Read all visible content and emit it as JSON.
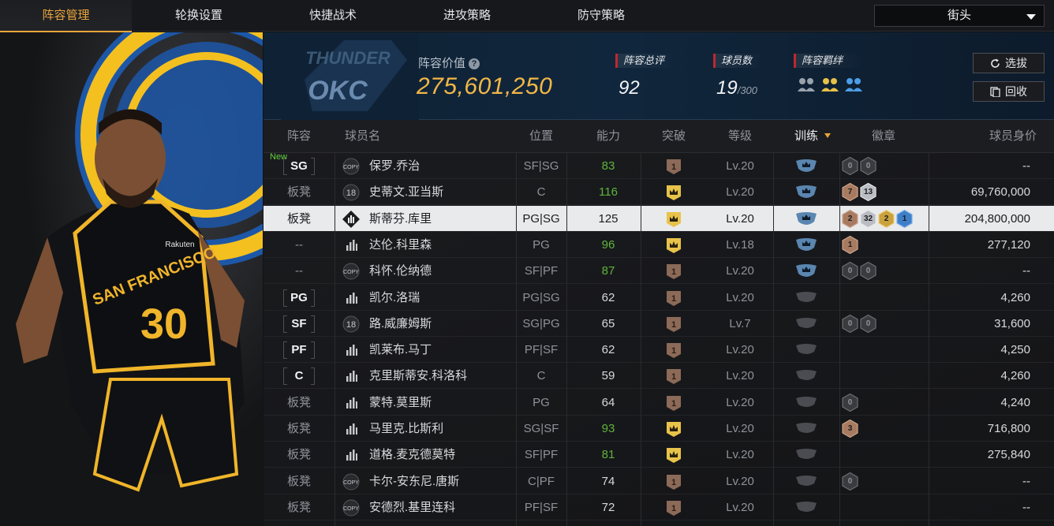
{
  "nav": {
    "tabs": [
      {
        "label": "阵容管理",
        "active": true
      },
      {
        "label": "轮换设置",
        "active": false
      },
      {
        "label": "快捷战术",
        "active": false
      },
      {
        "label": "进攻策略",
        "active": false
      },
      {
        "label": "防守策略",
        "active": false
      }
    ],
    "mode_select": "街头"
  },
  "header": {
    "value_label": "阵容价值",
    "value": "275,601,250",
    "rating_label": "阵容总评",
    "rating": "92",
    "players_label": "球员数",
    "players": "19",
    "players_max": "/300",
    "bond_label": "阵容羁绊",
    "select_button": "选拔",
    "recycle_button": "回收"
  },
  "colors": {
    "accent": "#e8a53c",
    "value_gold": "#f2b746",
    "ability_green": "#5fb43c",
    "stat_red": "#c0272d"
  },
  "table": {
    "columns": [
      "阵容",
      "球员名",
      "位置",
      "能力",
      "突破",
      "等级",
      "训练",
      "徽章",
      "球员身价"
    ],
    "rows": [
      {
        "lineup": "SG",
        "lineup_type": "slot",
        "is_new": true,
        "new_label": "New",
        "tier": "copy",
        "name": "保罗.乔治",
        "position": "SF|SG",
        "ability": "83",
        "ability_green": true,
        "breakthrough": "1",
        "breakthrough_type": "brown",
        "level": "Lv.20",
        "trained": true,
        "badges": [
          {
            "c": "dark",
            "v": "0"
          },
          {
            "c": "dark",
            "v": "0"
          }
        ],
        "price": "--",
        "selected": false
      },
      {
        "lineup": "板凳",
        "lineup_type": "bench",
        "is_new": false,
        "tier": "18",
        "name": "史蒂文.亚当斯",
        "position": "C",
        "ability": "116",
        "ability_green": true,
        "breakthrough": "crown",
        "breakthrough_type": "gold",
        "level": "Lv.20",
        "trained": true,
        "badges": [
          {
            "c": "bronze",
            "v": "7"
          },
          {
            "c": "silver",
            "v": "13"
          }
        ],
        "price": "69,760,000",
        "selected": false
      },
      {
        "lineup": "板凳",
        "lineup_type": "bench",
        "is_new": false,
        "tier": "diamond",
        "name": "斯蒂芬.库里",
        "position": "PG|SG",
        "ability": "125",
        "ability_green": false,
        "breakthrough": "crown",
        "breakthrough_type": "gold",
        "level": "Lv.20",
        "trained": true,
        "badges": [
          {
            "c": "bronze",
            "v": "2"
          },
          {
            "c": "silver",
            "v": "32"
          },
          {
            "c": "gold",
            "v": "2"
          },
          {
            "c": "blue",
            "v": "1"
          }
        ],
        "price": "204,800,000",
        "selected": true
      },
      {
        "lineup": "--",
        "lineup_type": "none",
        "is_new": false,
        "tier": "bars",
        "name": "达伦.科里森",
        "position": "PG",
        "ability": "96",
        "ability_green": true,
        "breakthrough": "crown",
        "breakthrough_type": "gold",
        "level": "Lv.18",
        "trained": true,
        "badges": [
          {
            "c": "bronze",
            "v": "1"
          }
        ],
        "price": "277,120",
        "selected": false
      },
      {
        "lineup": "--",
        "lineup_type": "none",
        "is_new": false,
        "tier": "copy",
        "name": "科怀.伦纳德",
        "position": "SF|PF",
        "ability": "87",
        "ability_green": true,
        "breakthrough": "1",
        "breakthrough_type": "brown",
        "level": "Lv.20",
        "trained": true,
        "badges": [
          {
            "c": "dark",
            "v": "0"
          },
          {
            "c": "dark",
            "v": "0"
          }
        ],
        "price": "--",
        "selected": false
      },
      {
        "lineup": "PG",
        "lineup_type": "slot",
        "is_new": false,
        "tier": "bars",
        "name": "凯尔.洛瑞",
        "position": "PG|SG",
        "ability": "62",
        "ability_green": false,
        "breakthrough": "1",
        "breakthrough_type": "brown",
        "level": "Lv.20",
        "trained": false,
        "badges": [],
        "price": "4,260",
        "selected": false
      },
      {
        "lineup": "SF",
        "lineup_type": "slot",
        "is_new": false,
        "tier": "18",
        "name": "路.威廉姆斯",
        "position": "SG|PG",
        "ability": "65",
        "ability_green": false,
        "breakthrough": "1",
        "breakthrough_type": "brown",
        "level": "Lv.7",
        "trained": false,
        "badges": [
          {
            "c": "dark",
            "v": "0"
          },
          {
            "c": "dark",
            "v": "0"
          }
        ],
        "price": "31,600",
        "selected": false
      },
      {
        "lineup": "PF",
        "lineup_type": "slot",
        "is_new": false,
        "tier": "bars",
        "name": "凯莱布.马丁",
        "position": "PF|SF",
        "ability": "62",
        "ability_green": false,
        "breakthrough": "1",
        "breakthrough_type": "brown",
        "level": "Lv.20",
        "trained": false,
        "badges": [],
        "price": "4,250",
        "selected": false
      },
      {
        "lineup": "C",
        "lineup_type": "slot",
        "is_new": false,
        "tier": "bars",
        "name": "克里斯蒂安.科洛科",
        "position": "C",
        "ability": "59",
        "ability_green": false,
        "breakthrough": "1",
        "breakthrough_type": "brown",
        "level": "Lv.20",
        "trained": false,
        "badges": [],
        "price": "4,260",
        "selected": false
      },
      {
        "lineup": "板凳",
        "lineup_type": "bench",
        "is_new": false,
        "tier": "bars",
        "name": "蒙特.莫里斯",
        "position": "PG",
        "ability": "64",
        "ability_green": false,
        "breakthrough": "1",
        "breakthrough_type": "brown",
        "level": "Lv.20",
        "trained": false,
        "badges": [
          {
            "c": "dark",
            "v": "0"
          }
        ],
        "price": "4,240",
        "selected": false
      },
      {
        "lineup": "板凳",
        "lineup_type": "bench",
        "is_new": false,
        "tier": "bars",
        "name": "马里克.比斯利",
        "position": "SG|SF",
        "ability": "93",
        "ability_green": true,
        "breakthrough": "crown",
        "breakthrough_type": "gold",
        "level": "Lv.20",
        "trained": false,
        "badges": [
          {
            "c": "bronze",
            "v": "3"
          }
        ],
        "price": "716,800",
        "selected": false
      },
      {
        "lineup": "板凳",
        "lineup_type": "bench",
        "is_new": false,
        "tier": "bars",
        "name": "道格.麦克德莫特",
        "position": "SF|PF",
        "ability": "81",
        "ability_green": true,
        "breakthrough": "crown",
        "breakthrough_type": "gold",
        "level": "Lv.20",
        "trained": false,
        "badges": [],
        "price": "275,840",
        "selected": false
      },
      {
        "lineup": "板凳",
        "lineup_type": "bench",
        "is_new": false,
        "tier": "copy",
        "name": "卡尔-安东尼.唐斯",
        "position": "C|PF",
        "ability": "74",
        "ability_green": false,
        "breakthrough": "1",
        "breakthrough_type": "brown",
        "level": "Lv.20",
        "trained": false,
        "badges": [
          {
            "c": "dark",
            "v": "0"
          }
        ],
        "price": "--",
        "selected": false
      },
      {
        "lineup": "板凳",
        "lineup_type": "bench",
        "is_new": false,
        "tier": "copy",
        "name": "安德烈.基里连科",
        "position": "PF|SF",
        "ability": "72",
        "ability_green": false,
        "breakthrough": "1",
        "breakthrough_type": "brown",
        "level": "Lv.20",
        "trained": false,
        "badges": [],
        "price": "--",
        "selected": false
      }
    ]
  },
  "portrait": {
    "jersey_team": "SAN FRANCISCO",
    "jersey_number": "30",
    "sponsor": "Rakuten"
  },
  "team_logo": {
    "text": "OKC",
    "subtext": "THUNDER"
  },
  "tier_copy_text": "COPY"
}
